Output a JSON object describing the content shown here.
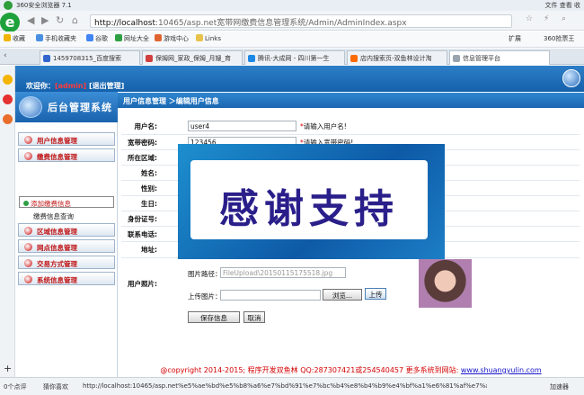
{
  "browser": {
    "title": "360安全浏览器 7.1",
    "title_menu": "文件  查看  收",
    "url_host": "http://localhost",
    "url_path": ":10465/asp.net宽带网缴费信息管理系统/Admin/AdminIndex.aspx",
    "bookmarks": [
      {
        "label": "收藏",
        "color": "#f0b400"
      },
      {
        "label": "手机收藏夹",
        "color": "#4a90e2"
      },
      {
        "label": "谷歌",
        "color": "#4285f4"
      },
      {
        "label": "网址大全",
        "color": "#2ea043"
      },
      {
        "label": "游戏中心",
        "color": "#e0642f"
      },
      {
        "label": "Links",
        "color": "#e8c24a"
      }
    ],
    "bookmarks_right": [
      "扩展",
      "360抢票王"
    ],
    "tabs": [
      {
        "label": "1459708315_百度搜索",
        "color": "#3366cc"
      },
      {
        "label": "保姆网_家政_保姆_月嫂_育",
        "color": "#d23f3f"
      },
      {
        "label": "腾讯-大成网 - 四川第一生",
        "color": "#1e88e5"
      },
      {
        "label": "店内搜索页-双鱼林设计淘",
        "color": "#ff6a00"
      },
      {
        "label": "信息管理平台",
        "color": "#9aa4ae"
      }
    ],
    "status_left": "0个点评",
    "status_mid": "猜你喜欢",
    "status_url": "http://localhost:10465/asp.net%e5%ae%bd%e5%b8%a6%e7%bd%91%e7%bc%b4%e8%b4%b9%e4%bf%a1%e6%81%af%e7%ae%a1%e7",
    "status_right": "加速器"
  },
  "admin": {
    "welcome_prefix": "欢迎你：",
    "welcome_user": "[admin]",
    "welcome_suffix": " [退出管理]",
    "logo_text": "后台管理系统",
    "breadcrumb": "用户信息管理 ＞编辑用户信息",
    "menu": [
      "用户信息管理",
      "缴费信息管理",
      "区域信息管理",
      "网点信息管理",
      "交易方式管理",
      "系统信息管理"
    ],
    "submenu": [
      "添加缴费信息",
      "缴费信息查询"
    ],
    "form": {
      "labels": [
        "用户名:",
        "宽带密码:",
        "所在区域:",
        "姓名:",
        "性别:",
        "生日:",
        "身份证号:",
        "联系电话:",
        "地址:",
        "用户照片:"
      ],
      "username_value": "user4",
      "username_hint": "请输入用户名!",
      "password_value": "123456",
      "password_hint": "请输入宽带密码!",
      "photo_path_label": "图片路径：",
      "photo_path_value": "FileUpload\\20150115175518.jpg",
      "upload_label": "上传图片：",
      "browse_button": "浏览...",
      "upload_button": "上传",
      "save_button": "保存信息",
      "cancel_button": "取消"
    },
    "overlay_text": "感谢支持",
    "footer_text": "@copyright 2014-2015; 程序开发双鱼林  QQ:287307421或254540457  更多系统到网站: ",
    "footer_link": "www.shuangyulin.com"
  }
}
